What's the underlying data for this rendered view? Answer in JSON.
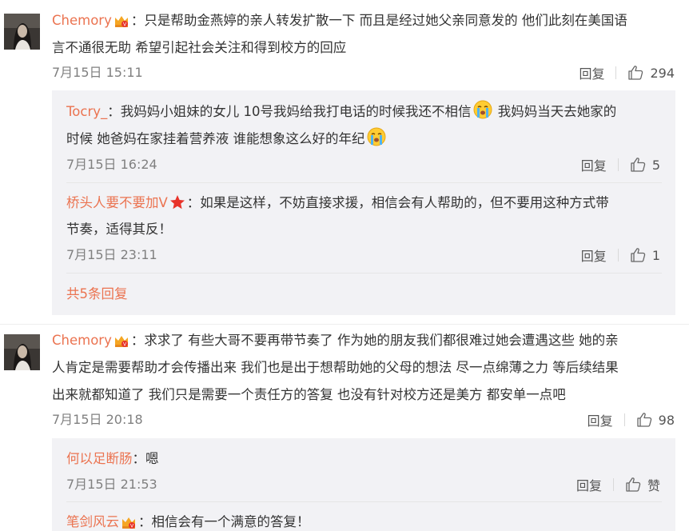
{
  "comments": [
    {
      "user": "Chemory",
      "line1": "：只是帮助金燕婷的亲人转发扩散一下 而且是经过她父亲同意发的 他们此刻在美国语",
      "line2": "言不通很无助 希望引起社会关注和得到校方的回应",
      "time": "7月15日 15:11",
      "reply_label": "回复",
      "likes": "294",
      "replies": [
        {
          "user": "Tocry_",
          "line1a": "：我妈妈小姐妹的女儿 10号我妈给我打电话的时候我还不相信",
          "line1b": " 我妈妈当天去她家的",
          "line2": "时候 她爸妈在家挂着营养液 谁能想象这么好的年纪",
          "time": "7月15日 16:24",
          "reply_label": "回复",
          "likes": "5"
        },
        {
          "user": "桥头人要不要加V",
          "line1": "：如果是这样，不妨直接求援，相信会有人帮助的，但不要用这种方式带",
          "line2": "节奏，适得其反！",
          "time": "7月15日 23:11",
          "reply_label": "回复",
          "likes": "1"
        }
      ],
      "more_replies": "共5条回复"
    },
    {
      "user": "Chemory",
      "line1": "：求求了 有些大哥不要再带节奏了 作为她的朋友我们都很难过她会遭遇这些 她的亲",
      "line2": "人肯定是需要帮助才会传播出来 我们也是出于想帮助她的父母的想法 尽一点绵薄之力 等后续结果",
      "line3": "出来就都知道了 我们只是需要一个责任方的答复 也没有针对校方还是美方 都安单一点吧",
      "time": "7月15日 20:18",
      "reply_label": "回复",
      "likes": "98",
      "replies": [
        {
          "user": "何以足断肠",
          "line1": "：嗯",
          "time": "7月15日 21:53",
          "reply_label": "回复",
          "likes": "赞"
        },
        {
          "user": "笔剑风云",
          "line1": "：相信会有一个满意的答复！"
        }
      ]
    }
  ],
  "icons": {
    "like": "thumbs-up-icon",
    "vip": "vip-crown-icon",
    "crying": "crying-emoji-icon",
    "star": "star-badge-icon"
  },
  "colors": {
    "username": "#eb7350",
    "text": "#333333",
    "meta": "#808080",
    "reply_bg": "#f2f2f5"
  }
}
